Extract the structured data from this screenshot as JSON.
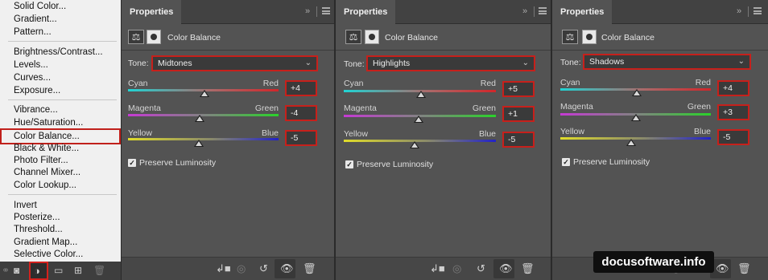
{
  "menu": {
    "items": [
      "Solid Color...",
      "Gradient...",
      "Pattern...",
      "Brightness/Contrast...",
      "Levels...",
      "Curves...",
      "Exposure...",
      "Vibrance...",
      "Hue/Saturation...",
      "Color Balance...",
      "Black & White...",
      "Photo Filter...",
      "Channel Mixer...",
      "Color Lookup...",
      "Invert",
      "Posterize...",
      "Threshold...",
      "Gradient Map...",
      "Selective Color..."
    ],
    "highlighted": "Color Balance...",
    "bottom_icons": [
      "link-icon",
      "add-mask-icon",
      "adjustment-layer-icon",
      "folder-icon",
      "new-layer-icon",
      "trash-icon"
    ],
    "highlight_color": "#c0201b"
  },
  "panels": [
    {
      "tab": "Properties",
      "adjustment": "Color Balance",
      "tone_label": "Tone:",
      "tone": "Midtones",
      "sliders": [
        {
          "left": "Cyan",
          "right": "Red",
          "value": "+4",
          "level": 4
        },
        {
          "left": "Magenta",
          "right": "Green",
          "value": "-4",
          "level": -4
        },
        {
          "left": "Yellow",
          "right": "Blue",
          "value": "-5",
          "level": -5
        }
      ],
      "preserve_label": "Preserve Luminosity",
      "preserve_checked": true
    },
    {
      "tab": "Properties",
      "adjustment": "Color Balance",
      "tone_label": "Tone:",
      "tone": "Highlights",
      "sliders": [
        {
          "left": "Cyan",
          "right": "Red",
          "value": "+5",
          "level": 5
        },
        {
          "left": "Magenta",
          "right": "Green",
          "value": "+1",
          "level": 1
        },
        {
          "left": "Yellow",
          "right": "Blue",
          "value": "-5",
          "level": -5
        }
      ],
      "preserve_label": "Preserve Luminosity",
      "preserve_checked": true
    },
    {
      "tab": "Properties",
      "adjustment": "Color Balance",
      "tone_label": "Tone:",
      "tone": "Shadows",
      "sliders": [
        {
          "left": "Cyan",
          "right": "Red",
          "value": "+4",
          "level": 4
        },
        {
          "left": "Magenta",
          "right": "Green",
          "value": "+3",
          "level": 3
        },
        {
          "left": "Yellow",
          "right": "Blue",
          "value": "-5",
          "level": -5
        }
      ],
      "preserve_label": "Preserve Luminosity",
      "preserve_checked": true
    }
  ],
  "panel_footer_icons": [
    "clip-to-layer-icon",
    "view-previous-icon",
    "reset-icon",
    "visibility-eye-icon",
    "trash-icon"
  ],
  "header_icons": [
    "collapse-double-chevron-icon",
    "panel-menu-icon"
  ],
  "watermark": "docusoftware.info",
  "colors": {
    "panel_bg": "#535353",
    "highlight_border": "#c7201b",
    "menu_bg": "#f0f0f0"
  }
}
